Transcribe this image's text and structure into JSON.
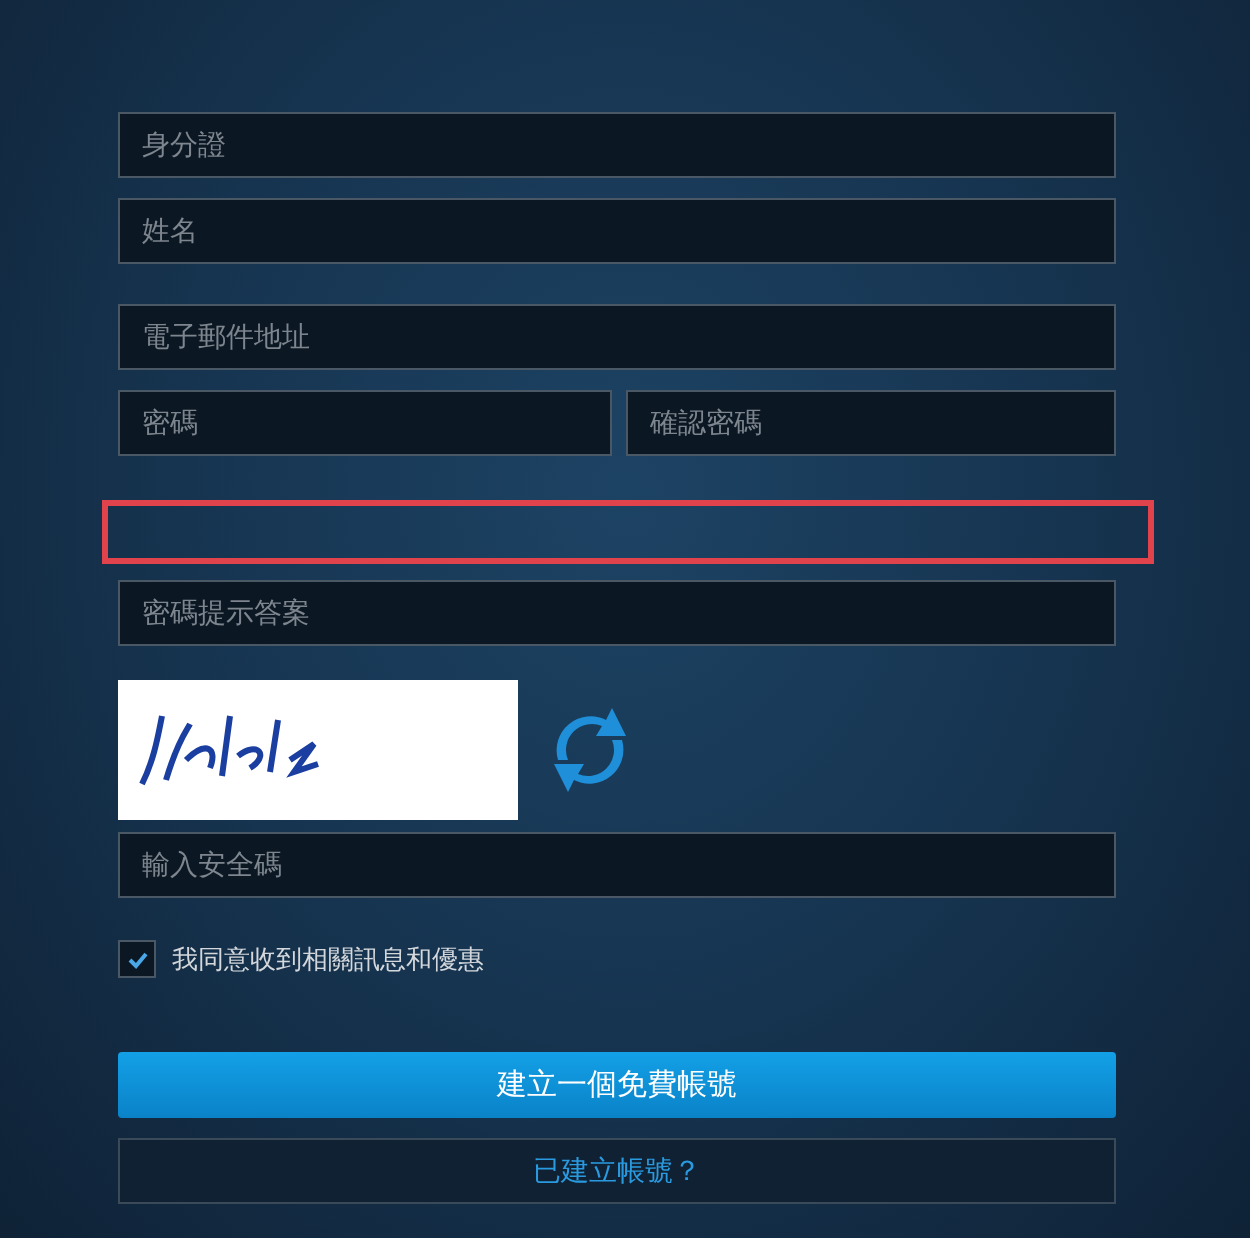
{
  "fields_top": [
    {
      "placeholder": "身分證"
    },
    {
      "placeholder": "姓名"
    }
  ],
  "email": {
    "placeholder": "電子郵件地址"
  },
  "passwords": [
    {
      "placeholder": "密碼"
    },
    {
      "placeholder": "確認密碼"
    }
  ],
  "hint_question": {
    "highlighted": true
  },
  "hint_answer": {
    "placeholder": "密碼提示答案"
  },
  "security_code": {
    "placeholder": "輸入安全碼"
  },
  "consent": {
    "label": "我同意收到相關訊息和優惠",
    "checked": true
  },
  "submit_button": "建立一個免費帳號",
  "login_link": "已建立帳號？"
}
